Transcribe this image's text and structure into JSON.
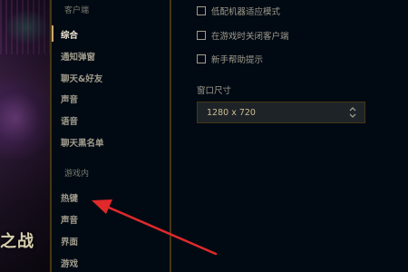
{
  "art": {
    "title": "之战"
  },
  "sidebar": {
    "client_section": "客户端",
    "client_items": [
      {
        "label": "综合"
      },
      {
        "label": "通知弹窗"
      },
      {
        "label": "聊天&好友"
      },
      {
        "label": "声音"
      },
      {
        "label": "语音"
      },
      {
        "label": "聊天黑名单"
      }
    ],
    "ingame_section": "游戏内",
    "ingame_items": [
      {
        "label": "热键"
      },
      {
        "label": "声音"
      },
      {
        "label": "界面"
      },
      {
        "label": "游戏"
      }
    ],
    "active_item": "综合"
  },
  "main": {
    "checkboxes": [
      {
        "label": "低配机器适应模式",
        "checked": false
      },
      {
        "label": "在游戏时关闭客户端",
        "checked": false
      },
      {
        "label": "新手帮助提示",
        "checked": false
      }
    ],
    "window_size_label": "窗口尺寸",
    "window_size_value": "1280 x 720"
  },
  "colors": {
    "gold": "#c8aa6e",
    "text": "#a09b8c",
    "active_text": "#f0e6d2",
    "annotation_arrow": "#e0292b"
  }
}
